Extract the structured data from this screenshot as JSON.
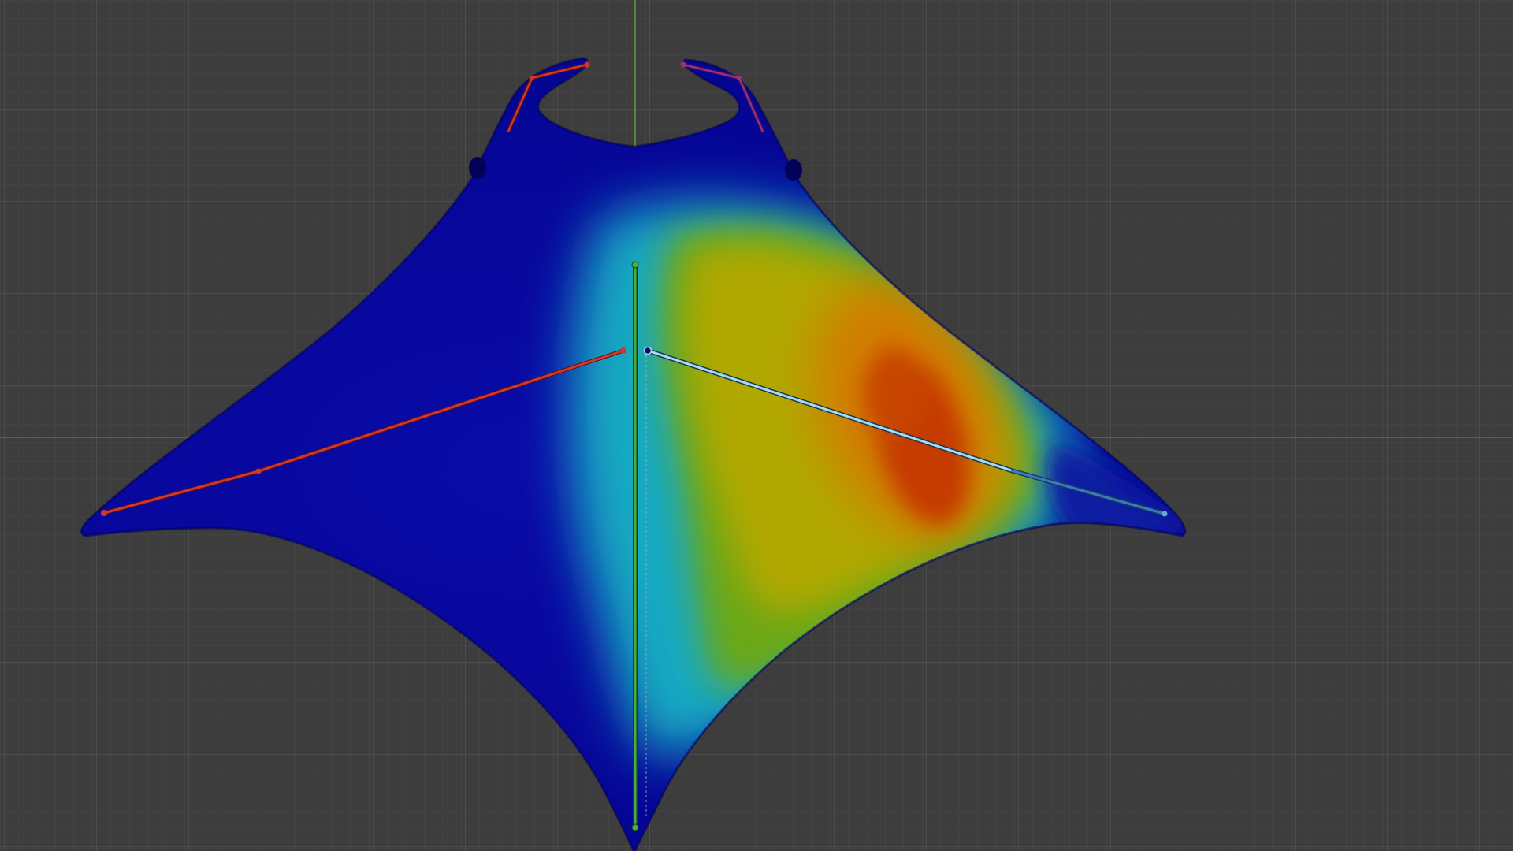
{
  "app": {
    "context": "3d-viewport",
    "mode": "weight-paint",
    "view": "top-orthographic"
  },
  "viewport": {
    "background_color": "#3d3d3d",
    "grid_minor_color": "#474747",
    "grid_major_color": "#535353",
    "x_axis_color": "#b24a4a",
    "y_axis_color": "#5fa83a",
    "grid_visible": true
  },
  "mesh": {
    "object": "manta-ray-mesh",
    "weight_gradient": [
      "#0a0a9c",
      "#1fb0c8",
      "#7fb01c",
      "#c2ad00",
      "#d06a00",
      "#c33000"
    ],
    "unweighted_color": "#00008f"
  },
  "armature": {
    "bones": [
      {
        "name": "spine-bone",
        "color": "#46b03a",
        "selected": false
      },
      {
        "name": "left-wing-bone",
        "color": "#d1372f",
        "selected": false
      },
      {
        "name": "right-wing-bone",
        "color": "#9fd8f0",
        "selected": true
      },
      {
        "name": "left-cephalic-fin-bone",
        "color": "#d1372f",
        "selected": false
      },
      {
        "name": "right-cephalic-fin-bone",
        "color": "#d1372f",
        "selected": false
      }
    ]
  }
}
